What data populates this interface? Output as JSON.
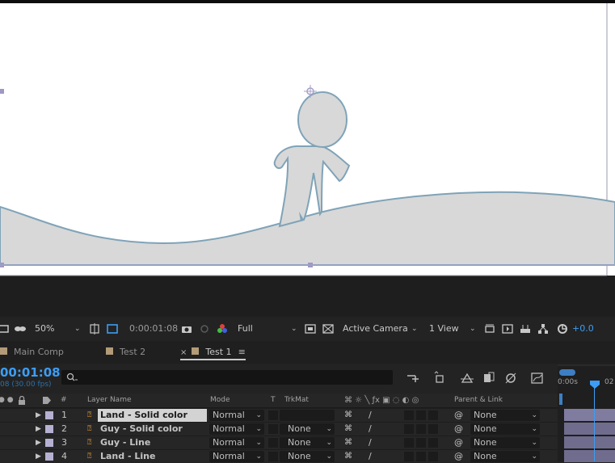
{
  "toolbar": {
    "zoom": "50%",
    "timecode": "0:00:01:08",
    "resolution": "Full",
    "camera": "Active Camera",
    "views": "1 View",
    "exposure": "+0.0"
  },
  "tabs": [
    {
      "label": "Main Comp",
      "active": false
    },
    {
      "label": "Test 2",
      "active": false
    },
    {
      "label": "Test 1",
      "active": true
    }
  ],
  "timeline": {
    "timecode": "00:01:08",
    "fps": "08 (30.00 fps)",
    "ruler": [
      "0:00s",
      "02"
    ]
  },
  "columns": {
    "number": "#",
    "layer_name": "Layer Name",
    "mode": "Mode",
    "t": "T",
    "trkmat": "TrkMat",
    "parent": "Parent & Link"
  },
  "layers": [
    {
      "num": "1",
      "name": "Land - Solid color",
      "mode": "Normal",
      "trkmat": "",
      "parent": "None",
      "selected": true
    },
    {
      "num": "2",
      "name": "Guy - Solid color",
      "mode": "Normal",
      "trkmat": "None",
      "parent": "None",
      "selected": false
    },
    {
      "num": "3",
      "name": "Guy - Line",
      "mode": "Normal",
      "trkmat": "None",
      "parent": "None",
      "selected": false
    },
    {
      "num": "4",
      "name": "Land - Line",
      "mode": "Normal",
      "trkmat": "None",
      "parent": "None",
      "selected": false
    }
  ],
  "colors": {
    "accent": "#3d9df3",
    "label_purple": "#b6b0d2",
    "shape_fill": "#d8d8d8",
    "shape_stroke": "#7fa3b8"
  }
}
